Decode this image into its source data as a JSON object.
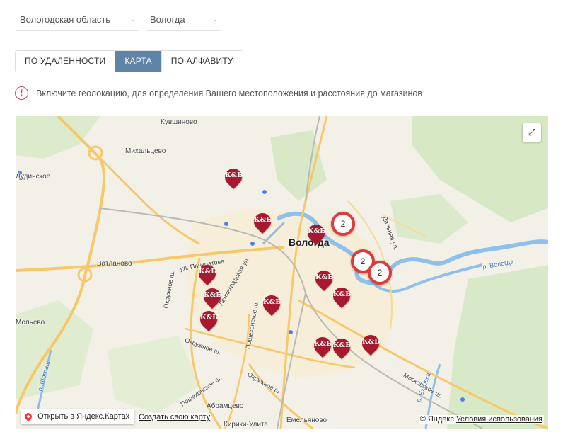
{
  "filters": {
    "region": "Вологодская область",
    "city": "Вологда"
  },
  "tabs": [
    {
      "label": "ПО УДАЛЕННОСТИ",
      "active": false
    },
    {
      "label": "КАРТА",
      "active": true
    },
    {
      "label": "ПО АЛФАВИТУ",
      "active": false
    }
  ],
  "geo_notice": "Включите геолокацию, для определения Вашего местоположения и расстояния до магазинов",
  "map": {
    "city_label": "Вологда",
    "place_labels": [
      "Кувшиново",
      "Михальцево",
      "Дудинское",
      "Ватланово",
      "Мольево",
      "Абрамцево",
      "Емельяново",
      "Кирики-Улита"
    ],
    "street_labels": [
      "ул. Панкратова",
      "Окружное ш.",
      "Окружное ш.",
      "Окружное ш.",
      "Пошехонское ш.",
      "Пошехонское ш.",
      "Ленинградская ул.",
      "Московское ш.",
      "Дальняя ул.",
      "р. Вологда",
      "р. Шограш",
      "р. Ехтовка"
    ],
    "store_marker_text": "К&Б",
    "store_marker_count": 12,
    "clusters": [
      "2",
      "2",
      "2"
    ],
    "fullscreen_icon": "expand-icon",
    "open_yandex": "Открыть в Яндекс.Картах",
    "create_map": "Создать свою карту",
    "copyright": "© Яндекс",
    "terms": "Условия использования"
  },
  "colors": {
    "active_tab": "#5e84a8",
    "marker": "#a6192e",
    "cluster_ring": "#e03a3a",
    "river": "#6fa8dc",
    "road": "#f7c86a"
  }
}
